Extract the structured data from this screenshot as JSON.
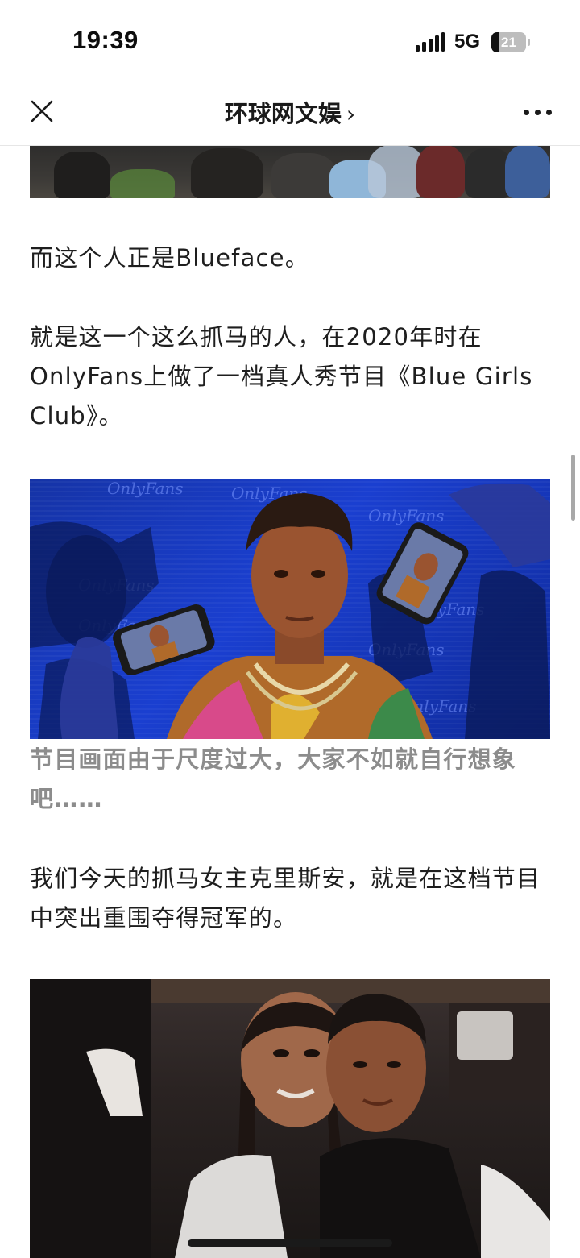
{
  "status_bar": {
    "time": "19:39",
    "network": "5G",
    "battery": "21",
    "battery_level": 0.21
  },
  "nav": {
    "title": "环球网文娱",
    "title_chevron": "›",
    "close_icon": "close-icon",
    "more_icon": "more-icon"
  },
  "article": {
    "paragraphs": [
      "而这个人正是Blueface。",
      "就是这一个这么抓马的人，在2020年时在OnlyFans上做了一档真人秀节目《Blue Girls Club》。",
      "我们今天的抓马女主克里斯安，就是在这档节目中突出重围夺得冠军的。"
    ],
    "caption": "节目画面由于尺度过大，大家不如就自行想象吧……",
    "image_watermark": "OnlyFans"
  }
}
